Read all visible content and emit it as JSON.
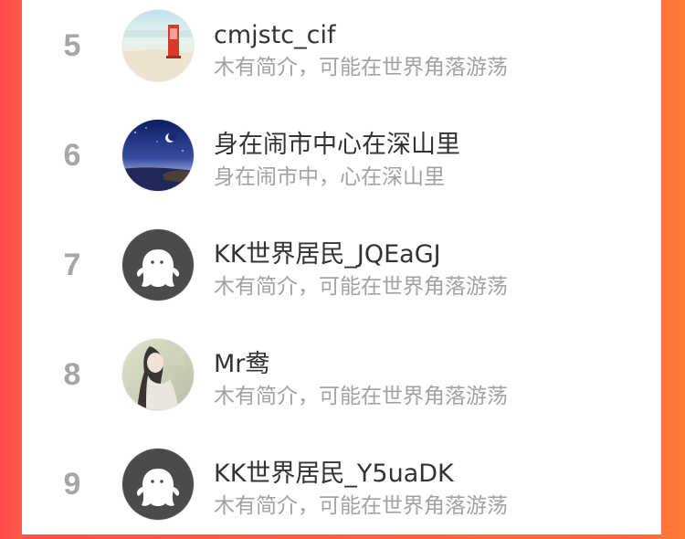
{
  "ranking": {
    "items": [
      {
        "rank": "5",
        "name": "cmjstc_cif",
        "bio": "木有简介，可能在世界角落游荡",
        "avatar_icon": "beach-red-phonebox-avatar"
      },
      {
        "rank": "6",
        "name": "身在闹市中心在深山里",
        "bio": "身在闹市中，心在深山里",
        "avatar_icon": "night-sky-moon-avatar"
      },
      {
        "rank": "7",
        "name": "KK世界居民_JQEaGJ",
        "bio": "木有简介，可能在世界角落游荡",
        "avatar_icon": "default-ghost-avatar"
      },
      {
        "rank": "8",
        "name": "Mr鸯",
        "bio": "木有简介，可能在世界角落游荡",
        "avatar_icon": "ancient-style-portrait-avatar"
      },
      {
        "rank": "9",
        "name": "KK世界居民_Y5uaDK",
        "bio": "木有简介，可能在世界角落游荡",
        "avatar_icon": "default-ghost-avatar"
      }
    ]
  },
  "colors": {
    "background_left": "#ff4a4f",
    "background_right": "#ff7a34",
    "card": "#ffffff",
    "rank_text": "#a6a6a6",
    "name_text": "#333333",
    "bio_text": "#a2a2a2"
  }
}
